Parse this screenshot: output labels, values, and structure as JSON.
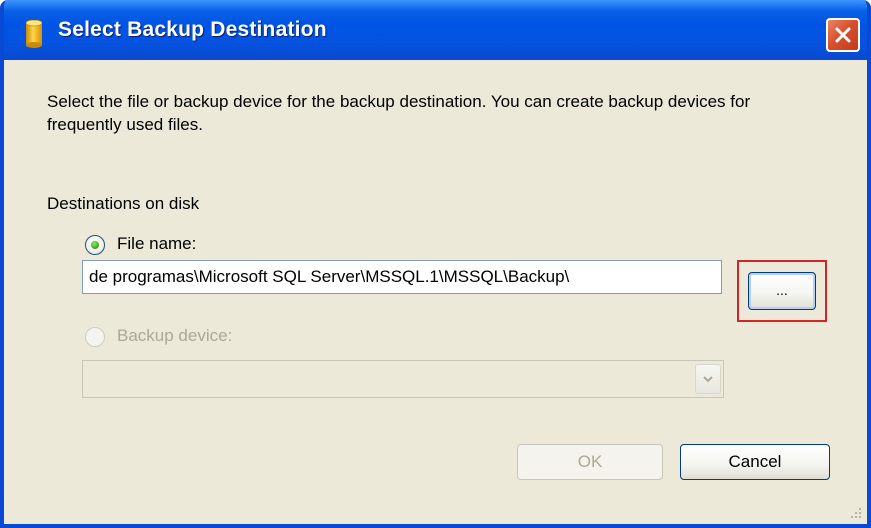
{
  "window": {
    "title": "Select Backup Destination",
    "title_icon": "database-icon",
    "close_icon": "close-icon",
    "colors": {
      "titlebar": "#0054e3",
      "client_bg": "#ece9d8",
      "close_button": "#d7512f",
      "highlight_box": "#d0262a"
    }
  },
  "content": {
    "description": "Select the file or backup device for the backup destination. You can create backup devices for frequently used files.",
    "group_label": "Destinations on disk",
    "file_name": {
      "label": "File name:",
      "selected": true,
      "value": "de programas\\Microsoft SQL Server\\MSSQL.1\\MSSQL\\Backup\\"
    },
    "browse_button": {
      "label": "...",
      "highlighted": true
    },
    "backup_device": {
      "label": "Backup device:",
      "selected": false,
      "enabled": false,
      "value": ""
    }
  },
  "buttons": {
    "ok": {
      "label": "OK",
      "enabled": false
    },
    "cancel": {
      "label": "Cancel",
      "enabled": true
    }
  }
}
